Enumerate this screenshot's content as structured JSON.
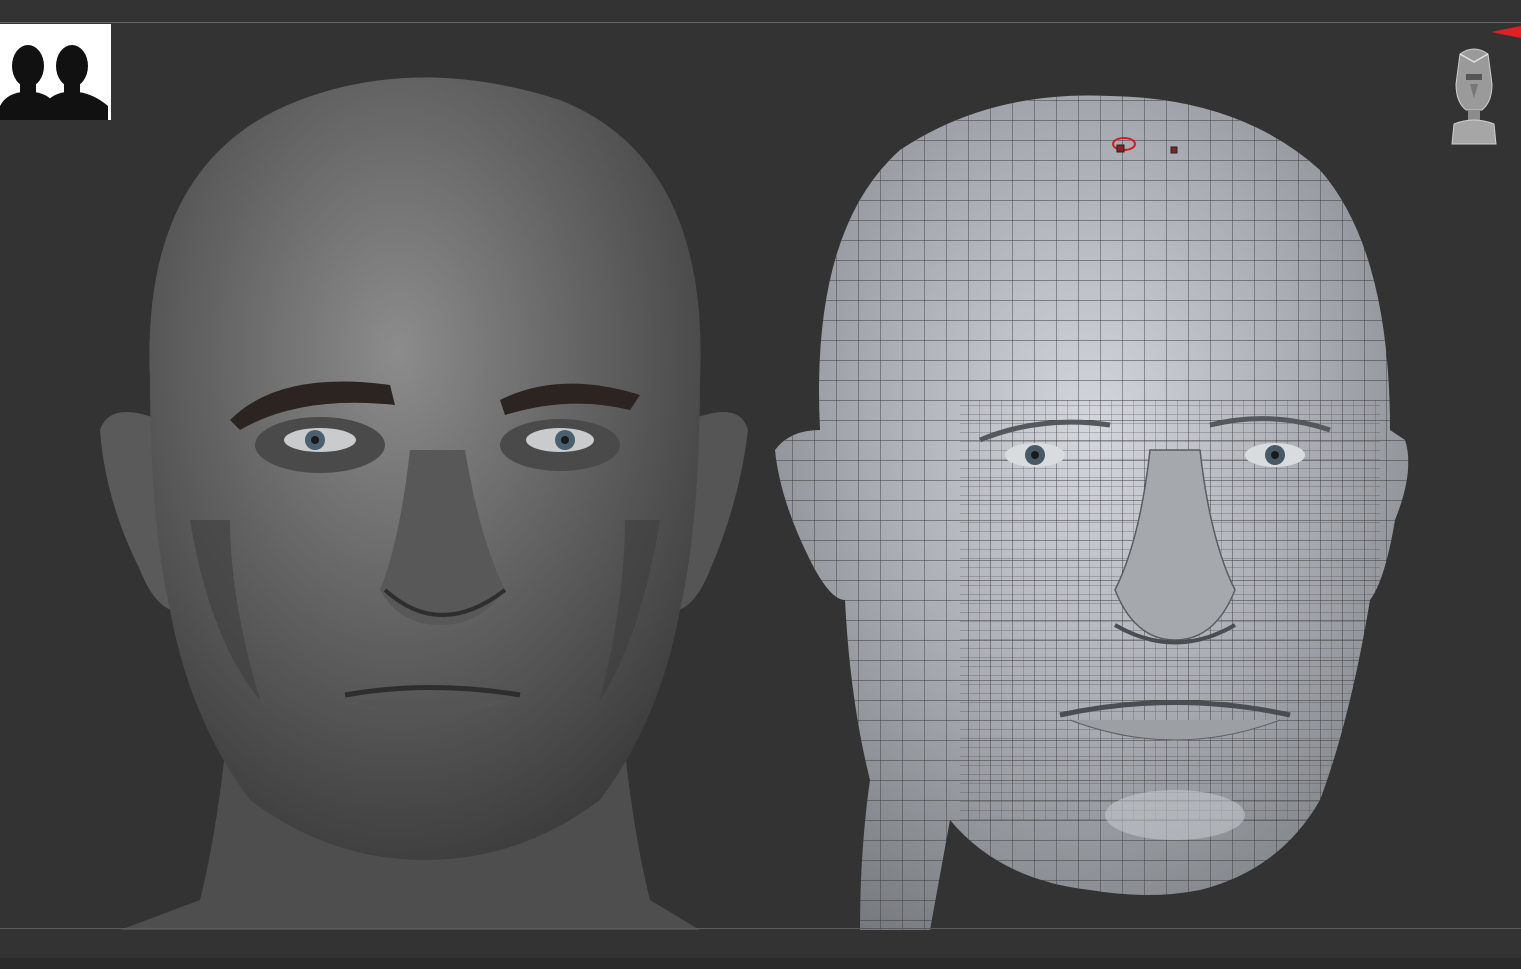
{
  "canvas": {
    "background": "#333333",
    "accent": "#e02020"
  },
  "thumbnail": {
    "icon": "two-heads-silhouette-icon"
  },
  "models": {
    "left": "high-detail-sculpt",
    "right": "wireframe-topology"
  },
  "gizmo": {
    "icon": "navigation-head-gizmo-icon"
  }
}
